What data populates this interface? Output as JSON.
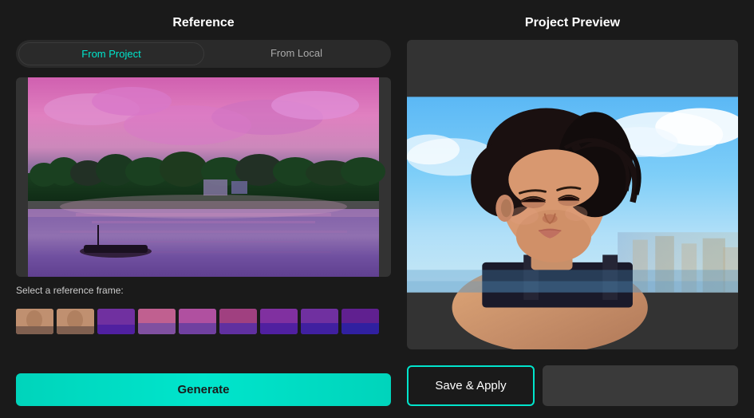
{
  "leftPanel": {
    "title": "Reference",
    "tabs": [
      {
        "label": "From Project",
        "active": true
      },
      {
        "label": "From Local",
        "active": false
      }
    ],
    "frameLabel": "Select a reference frame:",
    "generateBtn": "Generate"
  },
  "rightPanel": {
    "title": "Project Preview",
    "saveApplyBtn": "Save & Apply",
    "exportBtn": ""
  },
  "filmstrip": {
    "frames": [
      {
        "id": 1,
        "type": "face",
        "selected": false
      },
      {
        "id": 2,
        "type": "face",
        "selected": false
      },
      {
        "id": 3,
        "type": "dark",
        "selected": false
      },
      {
        "id": 4,
        "type": "lake",
        "selected": true
      },
      {
        "id": 5,
        "type": "lake",
        "selected": false
      },
      {
        "id": 6,
        "type": "lake",
        "selected": false
      },
      {
        "id": 7,
        "type": "dark",
        "selected": false
      },
      {
        "id": 8,
        "type": "dark",
        "selected": false
      },
      {
        "id": 9,
        "type": "dark",
        "selected": false
      }
    ]
  }
}
